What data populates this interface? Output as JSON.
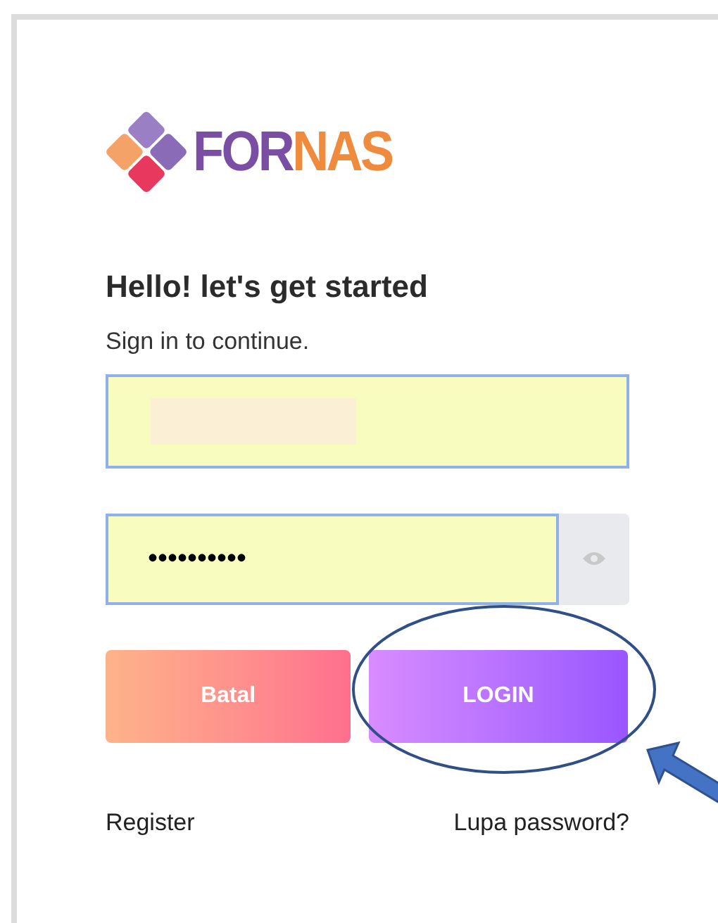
{
  "logo": {
    "parts": [
      "FOR",
      "NAS"
    ]
  },
  "heading": "Hello! let's get started",
  "subtitle": "Sign in to continue.",
  "username": {
    "redacted": true
  },
  "password": {
    "value": "••••••••••",
    "autofilled": true
  },
  "buttons": [
    {
      "kind": "cancel",
      "label": "Batal"
    },
    {
      "kind": "login",
      "label": "LOGIN",
      "highlighted": true
    }
  ],
  "links": [
    {
      "label": "Register"
    },
    {
      "label": "Lupa password?"
    }
  ]
}
